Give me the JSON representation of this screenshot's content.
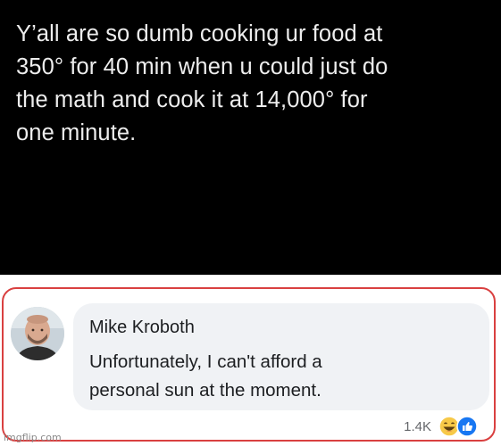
{
  "post": {
    "lines": [
      "Y’all are so dumb cooking ur food at",
      "350° for 40 min when u could just do",
      "the math and cook it at 14,000° for",
      "one minute."
    ]
  },
  "comment": {
    "author": "Mike Kroboth",
    "lines": [
      "Unfortunately, I can't afford a",
      "personal sun at the moment."
    ],
    "reaction_count": "1.4K",
    "reaction_icons": [
      "laughing-face-icon",
      "like-thumb-icon"
    ]
  },
  "watermark": "imgflip.com",
  "colors": {
    "post_bg": "#000000",
    "post_text": "#ededed",
    "frame_border": "#d94040",
    "bubble_bg": "#f0f2f5",
    "like_blue": "#1877f2",
    "haha_yellow": "#f7c948"
  }
}
